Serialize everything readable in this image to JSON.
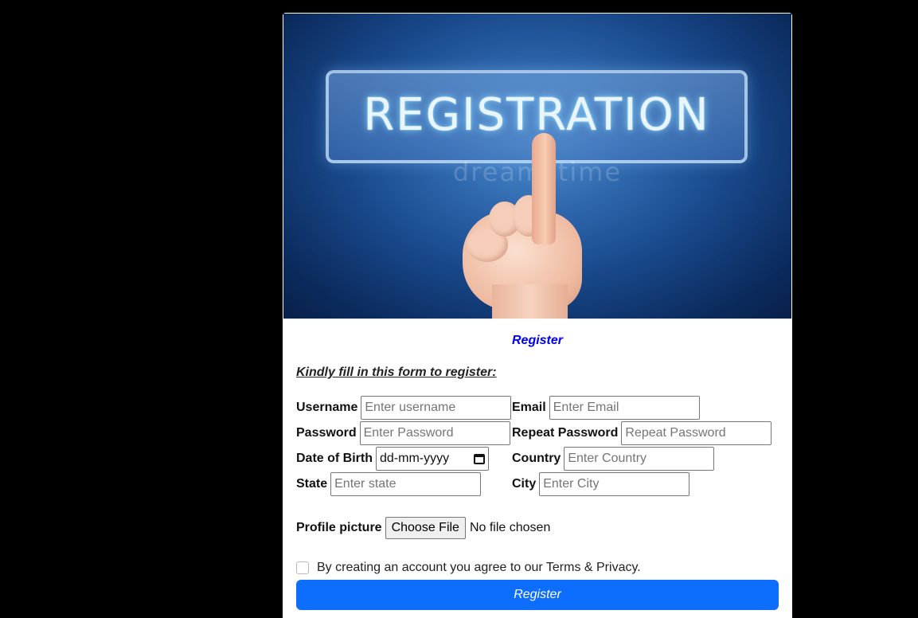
{
  "hero": {
    "banner_text": "REGISTRATION",
    "watermark": "dreamstime"
  },
  "form": {
    "title": "Register",
    "subtitle": "Kindly fill in this form to register:",
    "fields": {
      "username": {
        "label": "Username",
        "placeholder": "Enter username"
      },
      "email": {
        "label": "Email",
        "placeholder": "Enter Email"
      },
      "password": {
        "label": "Password",
        "placeholder": "Enter Password"
      },
      "repeat_password": {
        "label": "Repeat Password",
        "placeholder": "Repeat Password"
      },
      "dob": {
        "label": "Date of Birth",
        "value": "dd-mm-yyyy"
      },
      "country": {
        "label": "Country",
        "placeholder": "Enter Country"
      },
      "state": {
        "label": "State",
        "placeholder": "Enter state"
      },
      "city": {
        "label": "City",
        "placeholder": "Enter City"
      }
    },
    "profile_picture": {
      "label": "Profile picture",
      "button": "Choose File",
      "status": "No file chosen"
    },
    "terms": "By creating an account you agree to our Terms & Privacy.",
    "submit_label": "Register"
  },
  "colors": {
    "page_bg": "#000000",
    "title": "#0000ee",
    "submit_bg": "#0d6efd"
  }
}
